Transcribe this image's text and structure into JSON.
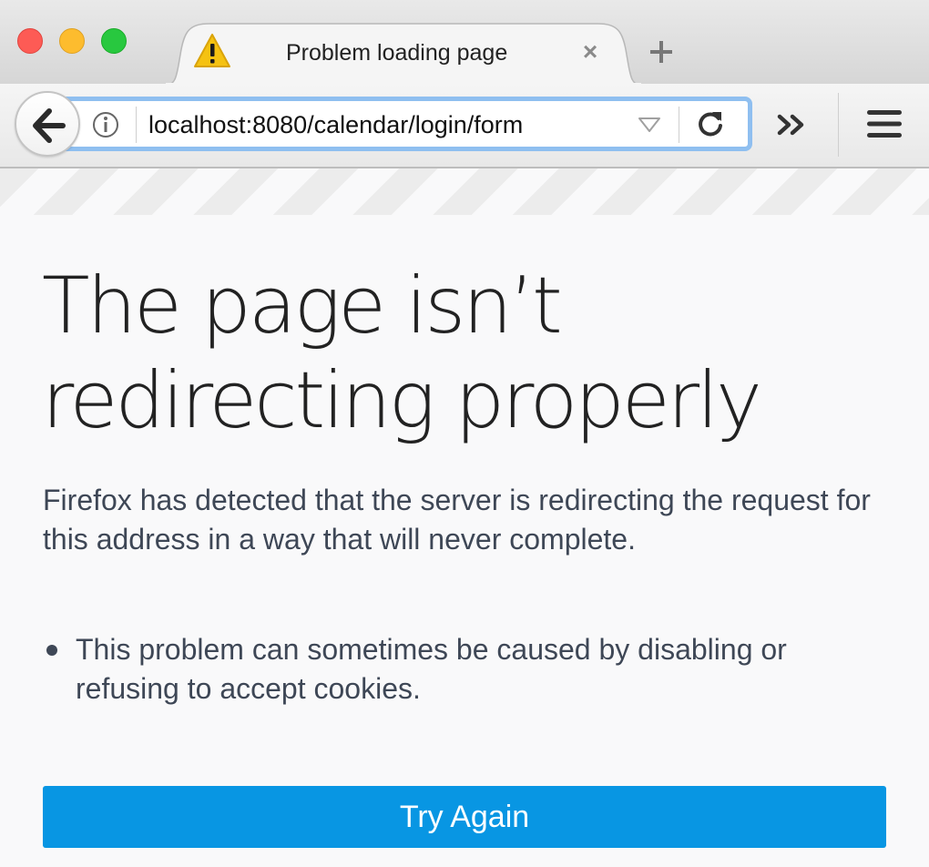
{
  "window": {
    "controls": [
      "close",
      "minimize",
      "maximize"
    ]
  },
  "tab": {
    "title": "Problem loading page",
    "icon": "warning-icon",
    "close_symbol": "×",
    "new_tab_icon": "plus-icon"
  },
  "navbar": {
    "back_icon": "back-arrow-icon",
    "info_icon": "info-icon",
    "url": "localhost:8080/calendar/login/form",
    "dropdown_icon": "dropdown-triangle-icon",
    "reload_icon": "reload-icon",
    "overflow_icon": "chevron-double-right-icon",
    "menu_icon": "hamburger-menu-icon"
  },
  "error": {
    "title": "The page isn’t redirecting properly",
    "description": "Firefox has detected that the server is redirecting the request for this address in a way that will never complete.",
    "list": [
      "This problem can sometimes be caused by disabling or refusing to accept cookies."
    ],
    "button_label": "Try Again"
  },
  "colors": {
    "accent": "#0896e3",
    "url_focus_ring": "#8fbff0",
    "text": "#3e4756",
    "title_text": "#222222",
    "close_light": "#fd5b55",
    "minimize_light": "#fdbc2e",
    "maximize_light": "#28c83f",
    "warning": "#f5c211"
  }
}
